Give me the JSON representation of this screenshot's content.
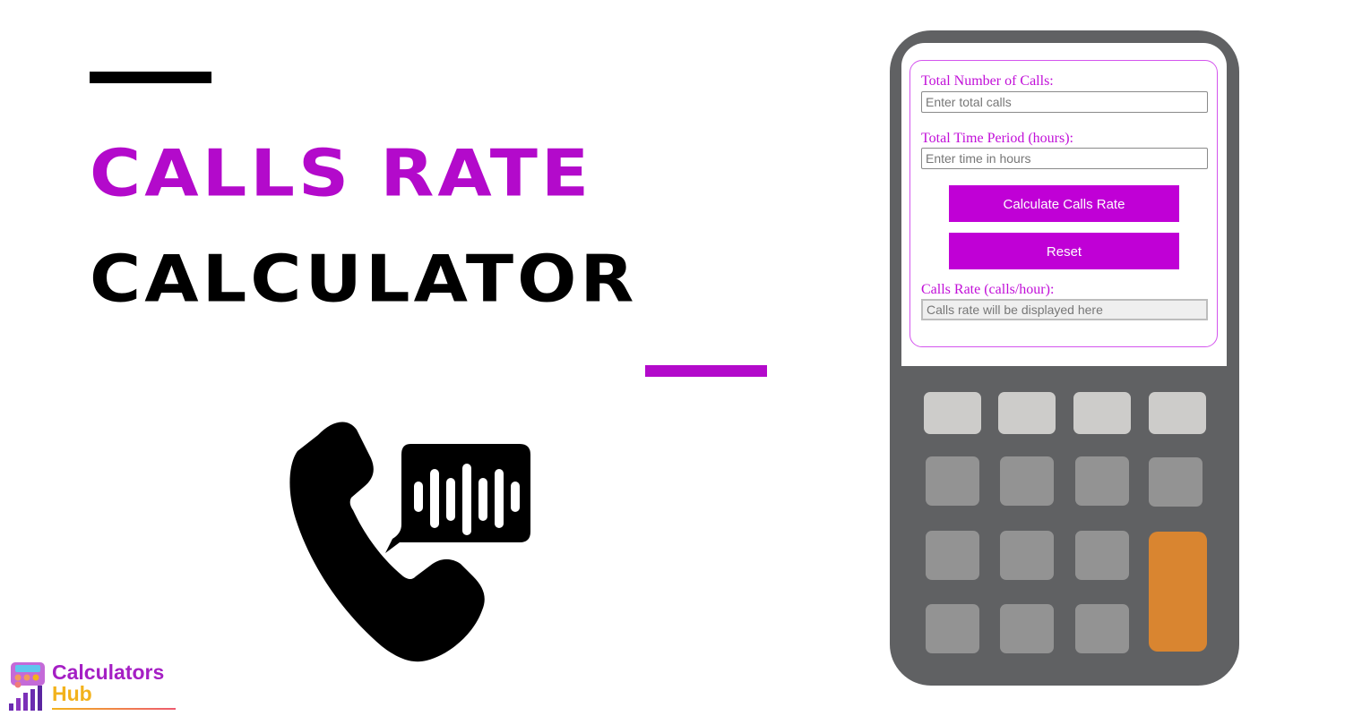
{
  "header": {
    "title_line1": "CALLS RATE",
    "title_line2": "CALCULATOR"
  },
  "colors": {
    "accent_purple": "#b30acb",
    "button_purple": "#c000d6",
    "label_purple": "#c10fd8",
    "calc_body": "#606163",
    "key_light": "#cdccca",
    "key_dark": "#939393",
    "key_orange": "#d98530"
  },
  "illustration": {
    "icon": "phone-with-voice-bubble-icon"
  },
  "calculator": {
    "fields": [
      {
        "label": "Total Number of Calls:",
        "placeholder": "Enter total calls",
        "value": ""
      },
      {
        "label": "Total Time Period (hours):",
        "placeholder": "Enter time in hours",
        "value": ""
      }
    ],
    "calculate_button": "Calculate Calls Rate",
    "reset_button": "Reset",
    "result": {
      "label": "Calls Rate (calls/hour):",
      "placeholder": "Calls rate will be displayed here",
      "value": ""
    }
  },
  "logo": {
    "line1": "Calculators",
    "line2": "Hub"
  }
}
